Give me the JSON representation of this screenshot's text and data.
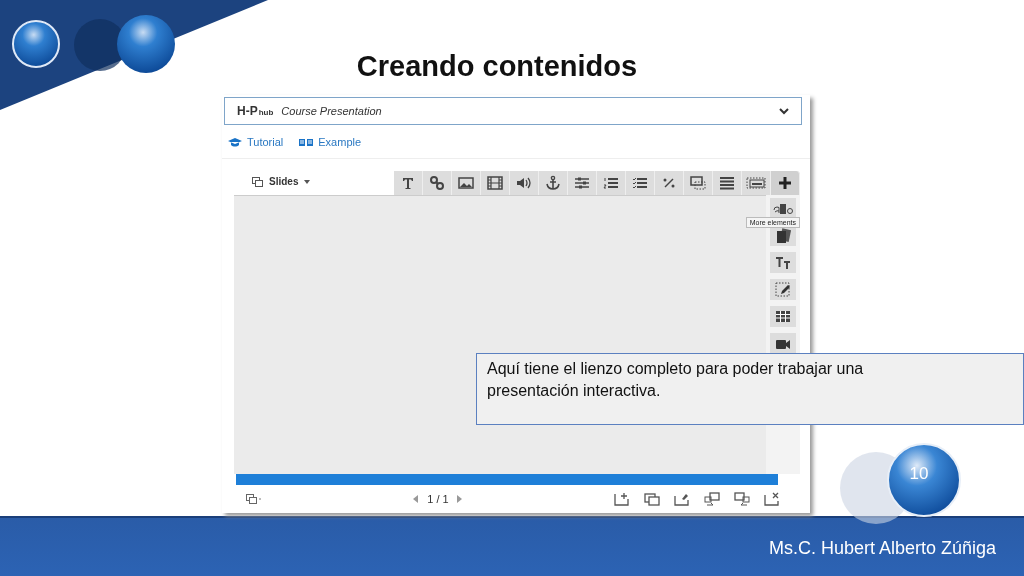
{
  "slide": {
    "title": "Creando contenidos",
    "page_number": "10",
    "author": "Ms.C. Hubert Alberto Zúñiga"
  },
  "editor": {
    "logo": "H-P",
    "logo_suffix": "hub",
    "content_type": "Course Presentation",
    "links": [
      {
        "label": "Tutorial"
      },
      {
        "label": "Example"
      }
    ],
    "slides_menu": "Slides",
    "tooltip": "More elements",
    "pager": "1 / 1",
    "progress": {
      "level": 1
    }
  },
  "callout": "Aquí tiene el lienzo completo para poder trabajar una presentación interactiva."
}
